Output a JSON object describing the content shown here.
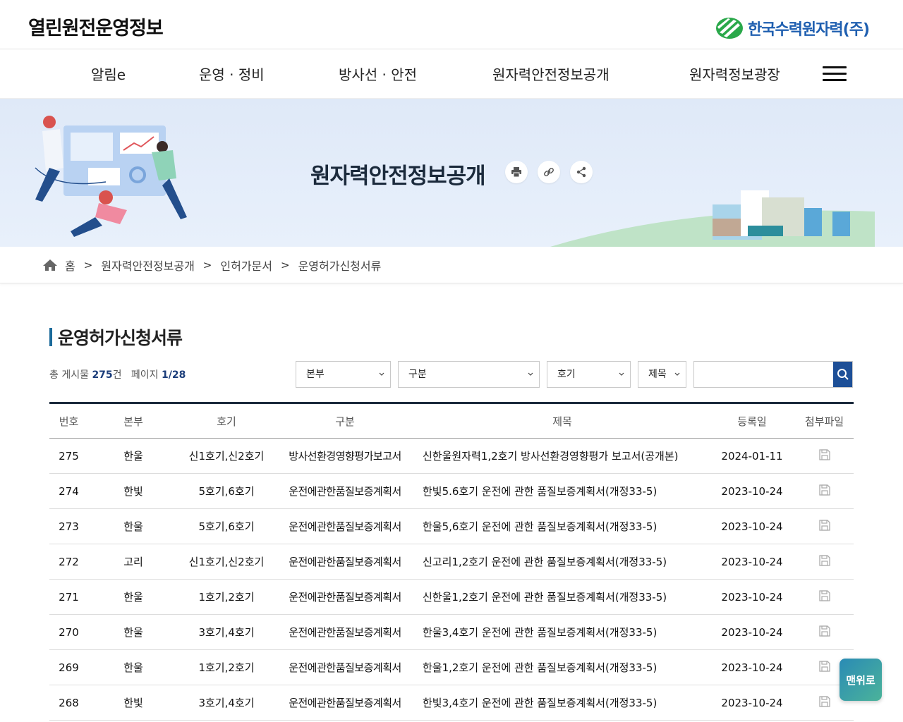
{
  "header": {
    "site_title": "열린원전운영정보",
    "brand_name": "한국수력원자력(주)"
  },
  "gnb": {
    "items": [
      "알림e",
      "운영 · 정비",
      "방사선 · 안전",
      "원자력안전정보공개",
      "원자력정보광장"
    ],
    "menu_icon": "hamburger-icon"
  },
  "banner": {
    "title": "원자력안전정보공개",
    "tools": [
      "print-icon",
      "link-icon",
      "share-icon"
    ]
  },
  "breadcrumb": {
    "home": "홈",
    "items": [
      "원자력안전정보공개",
      "인허가문서",
      "운영허가신청서류"
    ],
    "separator": ">"
  },
  "board": {
    "heading": "운영허가신청서류",
    "total_label": "총 게시물",
    "total_count": "275",
    "total_unit": "건",
    "page_label": "페이지",
    "page_value": "1/28",
    "filters": {
      "division": "본부",
      "category": "구분",
      "unit": "호기",
      "field": "제목",
      "search_value": ""
    },
    "columns": [
      "번호",
      "본부",
      "호기",
      "구분",
      "제목",
      "등록일",
      "첨부파일"
    ],
    "rows": [
      {
        "no": "275",
        "hq": "한울",
        "unit": "신1호기,신2호기",
        "gubun": "방사선환경영향평가보고서",
        "title": "신한울원자력1,2호기 방사선환경영향평가 보고서(공개본)",
        "date": "2024-01-11"
      },
      {
        "no": "274",
        "hq": "한빛",
        "unit": "5호기,6호기",
        "gubun": "운전에관한품질보증계획서",
        "title": "한빛5.6호기 운전에 관한 품질보증계획서(개정33-5)",
        "date": "2023-10-24"
      },
      {
        "no": "273",
        "hq": "한울",
        "unit": "5호기,6호기",
        "gubun": "운전에관한품질보증계획서",
        "title": "한울5,6호기 운전에 관한 품질보증계획서(개정33-5)",
        "date": "2023-10-24"
      },
      {
        "no": "272",
        "hq": "고리",
        "unit": "신1호기,신2호기",
        "gubun": "운전에관한품질보증계획서",
        "title": "신고리1,2호기 운전에 관한 품질보증계획서(개정33-5)",
        "date": "2023-10-24"
      },
      {
        "no": "271",
        "hq": "한울",
        "unit": "1호기,2호기",
        "gubun": "운전에관한품질보증계획서",
        "title": "신한울1,2호기 운전에 관한 품질보증계획서(개정33-5)",
        "date": "2023-10-24"
      },
      {
        "no": "270",
        "hq": "한울",
        "unit": "3호기,4호기",
        "gubun": "운전에관한품질보증계획서",
        "title": "한울3,4호기 운전에 관한 품질보증계획서(개정33-5)",
        "date": "2023-10-24"
      },
      {
        "no": "269",
        "hq": "한울",
        "unit": "1호기,2호기",
        "gubun": "운전에관한품질보증계획서",
        "title": "한울1,2호기 운전에 관한 품질보증계획서(개정33-5)",
        "date": "2023-10-24"
      },
      {
        "no": "268",
        "hq": "한빛",
        "unit": "3호기,4호기",
        "gubun": "운전에관한품질보증계획서",
        "title": "한빛3,4호기 운전에 관한 품질보증계획서(개정33-5)",
        "date": "2023-10-24"
      }
    ]
  },
  "top_button": "맨위로",
  "colors": {
    "accent": "#1d4f97",
    "table_top_border": "#1b2a3c",
    "banner_bg": "#dfe9f8"
  }
}
